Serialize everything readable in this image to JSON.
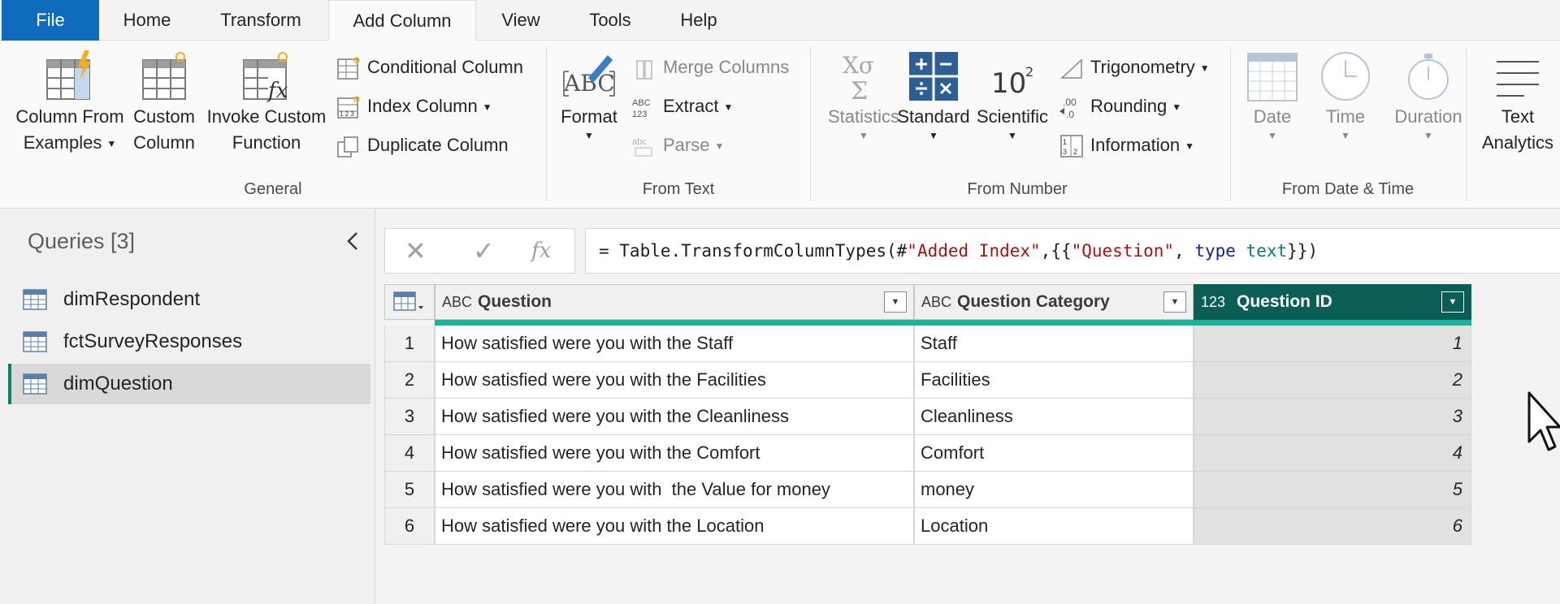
{
  "tabs": [
    {
      "label": "File"
    },
    {
      "label": "Home"
    },
    {
      "label": "Transform"
    },
    {
      "label": "Add Column"
    },
    {
      "label": "View"
    },
    {
      "label": "Tools"
    },
    {
      "label": "Help"
    }
  ],
  "ribbon": {
    "general": {
      "label": "General",
      "column_from_examples": [
        "Column From",
        "Examples"
      ],
      "custom_column": [
        "Custom",
        "Column"
      ],
      "invoke_custom_function": [
        "Invoke Custom",
        "Function"
      ],
      "conditional_column": "Conditional Column",
      "index_column": "Index Column",
      "duplicate_column": "Duplicate Column"
    },
    "from_text": {
      "label": "From Text",
      "format": "Format",
      "merge_columns": "Merge Columns",
      "extract": "Extract",
      "parse": "Parse"
    },
    "from_number": {
      "label": "From Number",
      "statistics": "Statistics",
      "standard": "Standard",
      "scientific": "Scientific",
      "trigonometry": "Trigonometry",
      "rounding": "Rounding",
      "information": "Information"
    },
    "from_datetime": {
      "label": "From Date & Time",
      "date": "Date",
      "time": "Time",
      "duration": "Duration"
    },
    "text_analytics": [
      "Text",
      "Analytics"
    ]
  },
  "queries": {
    "title": "Queries [3]",
    "items": [
      {
        "label": "dimRespondent"
      },
      {
        "label": "fctSurveyResponses"
      },
      {
        "label": "dimQuestion"
      }
    ]
  },
  "formula": {
    "prefix": "= Table.TransformColumnTypes(#",
    "s1": "\"Added Index\"",
    "mid1": ",{{",
    "s2": "\"Question\"",
    "mid2": ", ",
    "kw": "type",
    "sp": " ",
    "ty": "text",
    "suffix": "}})"
  },
  "grid": {
    "columns": [
      {
        "type_icon": "ABC",
        "name": "Question"
      },
      {
        "type_icon": "ABC",
        "name": "Question Category"
      },
      {
        "type_icon": "123",
        "name": "Question ID"
      }
    ],
    "rows": [
      {
        "n": "1",
        "question": "How satisfied were you with the Staff",
        "category": "Staff",
        "id": "1"
      },
      {
        "n": "2",
        "question": "How satisfied were you with the Facilities",
        "category": "Facilities",
        "id": "2"
      },
      {
        "n": "3",
        "question": "How satisfied were you with the Cleanliness",
        "category": "Cleanliness",
        "id": "3"
      },
      {
        "n": "4",
        "question": "How satisfied were you with the Comfort",
        "category": "Comfort",
        "id": "4"
      },
      {
        "n": "5",
        "question": "How satisfied were you with  the Value for money",
        "category": "money",
        "id": "5"
      },
      {
        "n": "6",
        "question": "How satisfied were you with the Location",
        "category": "Location",
        "id": "6"
      }
    ]
  },
  "colors": {
    "file_tab": "#0f6cbd",
    "selected_column_header": "#0b5e55",
    "column_quality_bar": "#1bb39e",
    "selected_query_accent": "#107c6a"
  }
}
